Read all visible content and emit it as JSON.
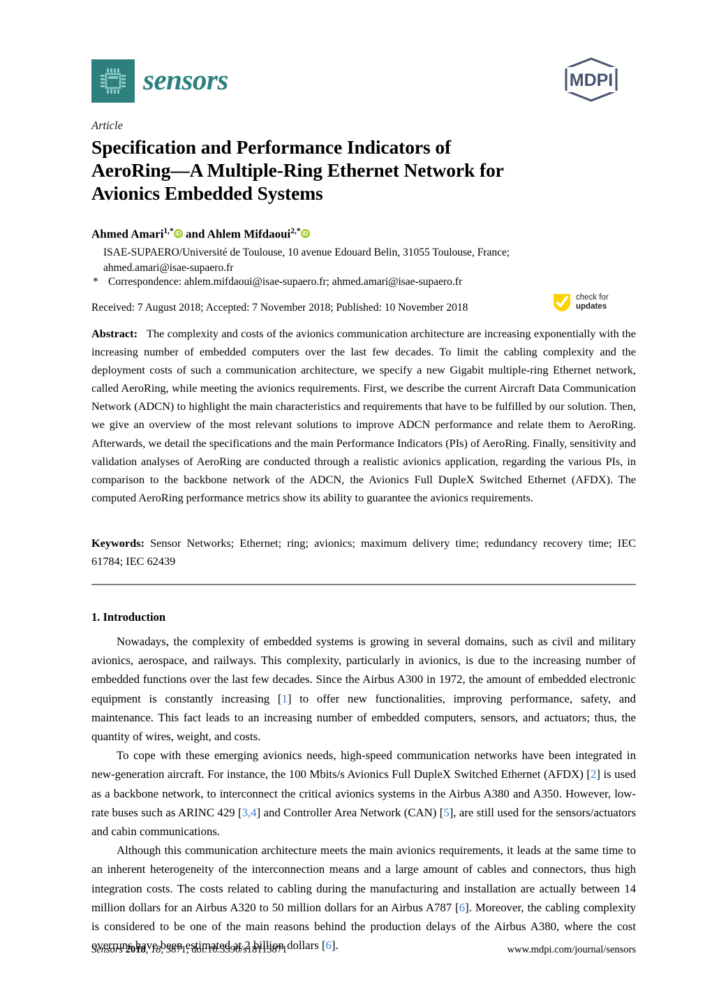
{
  "header": {
    "journal_name": "sensors",
    "journal_logo_icon": "microchip-icon",
    "publisher_logo_text": "MDPI",
    "logo_color": "#2d807d",
    "publisher_color": "#45536e"
  },
  "article": {
    "type": "Article",
    "title": "Specification and Performance Indicators of AeroRing—A Multiple-Ring Ethernet Network for Avionics Embedded Systems",
    "title_lines": [
      "Specification and Performance Indicators of",
      "AeroRing—A Multiple-Ring Ethernet Network for",
      "Avionics Embedded Systems"
    ]
  },
  "authors": {
    "author1_name": "Ahmed Amari",
    "author1_sup": "1,*",
    "conjunction": "and",
    "author2_name": "Ahlem Mifdaoui",
    "author2_sup": "2,*",
    "orcid_label": "iD",
    "orcid_color": "#a6ce39",
    "affiliation_line1": "ISAE-SUPAERO/Université de Toulouse, 10 avenue Edouard Belin, 31055 Toulouse, France;",
    "affiliation_line2": "ahmed.amari@isae-supaero.fr",
    "correspondence_marker": "*",
    "correspondence": "Correspondence: ahlem.mifdaoui@isae-supaero.fr; ahmed.amari@isae-supaero.fr"
  },
  "dates": {
    "line": "Received: 7 August 2018; Accepted: 7 November 2018; Published: 10 November 2018"
  },
  "crossmark": {
    "line1": "check for",
    "line2": "updates",
    "badge_color": "#fcd303",
    "icon": "check-mark-icon"
  },
  "abstract": {
    "label": "Abstract:",
    "text": "The complexity and costs of the avionics communication architecture are increasing exponentially with the increasing number of embedded computers over the last few decades. To limit the cabling complexity and the deployment costs of such a communication architecture, we specify a new Gigabit multiple-ring Ethernet network, called AeroRing, while meeting the avionics requirements. First, we describe the current Aircraft Data Communication Network (ADCN) to highlight the main characteristics and requirements that have to be fulfilled by our solution. Then, we give an overview of the most relevant solutions to improve ADCN performance and relate them to AeroRing. Afterwards, we detail the specifications and the main Performance Indicators (PIs) of AeroRing. Finally, sensitivity and validation analyses of AeroRing are conducted through a realistic avionics application, regarding the various PIs, in comparison to the backbone network of the ADCN, the Avionics Full DupleX Switched Ethernet (AFDX). The computed AeroRing performance metrics show its ability to guarantee the avionics requirements."
  },
  "keywords": {
    "label": "Keywords:",
    "text": "Sensor Networks; Ethernet; ring; avionics; maximum delivery time; redundancy recovery time; IEC 61784; IEC 62439"
  },
  "body": {
    "section_heading": "1. Introduction",
    "paragraph1_a": "Nowadays, the complexity of embedded systems is growing in several domains, such as civil and military avionics, aerospace, and railways. This complexity, particularly in avionics, is due to the increasing number of embedded functions over the last few decades. Since the Airbus A300 in 1972, the amount of embedded electronic equipment is constantly increasing [",
    "paragraph1_cite1": "1",
    "paragraph1_b": "] to offer new functionalities, improving performance, safety, and maintenance. This fact leads to an increasing number of embedded computers, sensors, and actuators; thus, the quantity of wires, weight, and costs.",
    "paragraph2_a": "To cope with these emerging avionics needs, high-speed communication networks have been integrated in new-generation aircraft. For instance, the 100 Mbits/s Avionics Full DupleX Switched Ethernet (AFDX) [",
    "paragraph2_cite1": "2",
    "paragraph2_b": "] is used as a backbone network, to interconnect the critical avionics systems in the Airbus A380 and A350. However, low-rate buses such as ARINC 429 [",
    "paragraph2_cite2": "3,4",
    "paragraph2_c": "] and Controller Area Network (CAN) [",
    "paragraph2_cite3": "5",
    "paragraph2_d": "], are still used for the sensors/actuators and cabin communications.",
    "paragraph3_a": "Although this communication architecture meets the main avionics requirements, it leads at the same time to an inherent heterogeneity of the interconnection means and a large amount of cables and connectors, thus high integration costs. The costs related to cabling during the manufacturing and installation are actually between 14 million dollars for an Airbus A320 to 50 million dollars for an Airbus A787 [",
    "paragraph3_cite1": "6",
    "paragraph3_b": "]. Moreover, the cabling complexity is considered to be one of the main reasons behind the production delays of the Airbus A380, where the cost overruns have been estimated at 2 billion dollars [",
    "paragraph3_cite2": "6",
    "paragraph3_c": "].",
    "citation_color": "#3a7fd5"
  },
  "footer": {
    "journal_italic": "Sensors",
    "year": "2018",
    "volume": "18",
    "rest": ", 3871; doi:10.3390/s18113871",
    "url": "www.mdpi.com/journal/sensors"
  }
}
